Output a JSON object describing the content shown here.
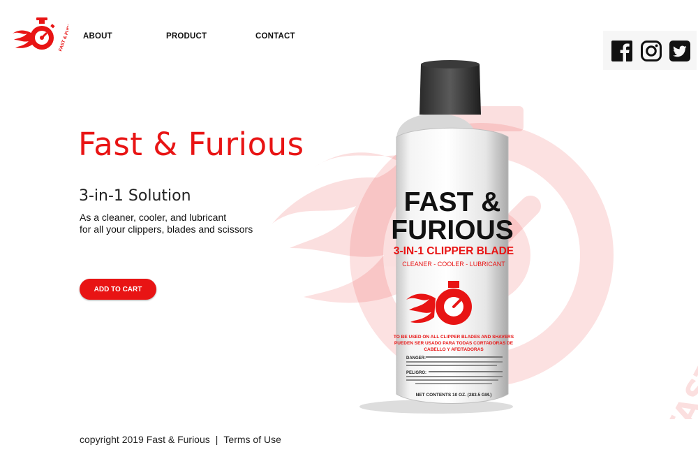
{
  "brand": {
    "logo_text": "FAST & FURIOUS",
    "accent_color": "#e81414"
  },
  "nav": {
    "items": [
      {
        "label": "ABOUT"
      },
      {
        "label": "PRODUCT"
      },
      {
        "label": "CONTACT"
      }
    ]
  },
  "social": {
    "icons": [
      "facebook-icon",
      "instagram-icon",
      "twitter-icon"
    ]
  },
  "hero": {
    "title": "Fast & Furious",
    "subtitle": "3-in-1 Solution",
    "description_line1": "As a cleaner, cooler, and lubricant",
    "description_line2": "for all your clippers, blades and scissors",
    "cta_label": "ADD TO CART"
  },
  "product": {
    "line1": "FAST &",
    "line2": "FURIOUS",
    "line3": "3-IN-1 CLIPPER BLADE",
    "line4": "CLEANER - COOLER - LUBRICANT",
    "line5": "TO BE USED ON ALL CLIPPER BLADES AND SHAVERS",
    "line6": "PUEDEN SER USADO PARA TODAS CORTADORAS DE",
    "line7": "CABELLO Y AFEITADORAS",
    "warning": "DANGER:",
    "peligro": "PELIGRO:",
    "net": "NET CONTENTS 10 OZ. (283.5 GM.)"
  },
  "watermark": {
    "text": "FAST & FURIOUS"
  },
  "footer": {
    "copyright": "copyright 2019 Fast & Furious",
    "separator": "|",
    "terms": "Terms of Use"
  }
}
